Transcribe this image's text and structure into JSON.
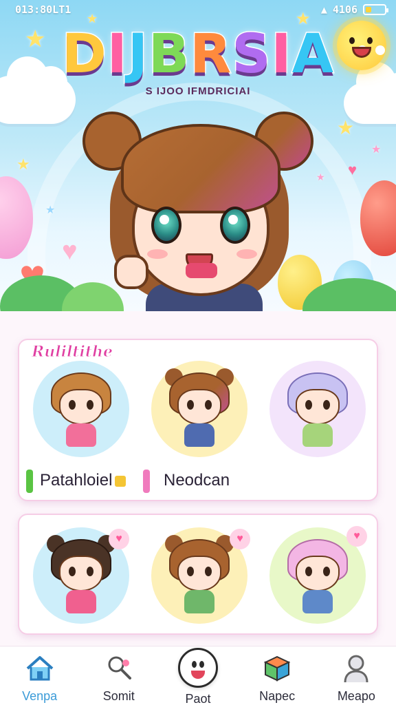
{
  "status_bar": {
    "time": "013:80LT1",
    "battery": "4106",
    "battery_level": 0.3
  },
  "hero": {
    "title": "DIJBRSIA",
    "subtitle": "S IJOO IFMDRICIAI"
  },
  "stickers_card": {
    "header": "Ruliltithe",
    "labels": [
      {
        "text": "Patahloiel",
        "bar_color": "#5ac443"
      },
      {
        "text": "Neodcan",
        "bar_color": "#f07bbd"
      }
    ]
  },
  "nav": {
    "items": [
      {
        "label": "Venpa",
        "icon": "house-icon"
      },
      {
        "label": "Somit",
        "icon": "search-phone-icon"
      },
      {
        "label": "Paot",
        "icon": "smiley-icon"
      },
      {
        "label": "Napec",
        "icon": "package-icon"
      },
      {
        "label": "Meapo",
        "icon": "user-icon"
      }
    ]
  }
}
